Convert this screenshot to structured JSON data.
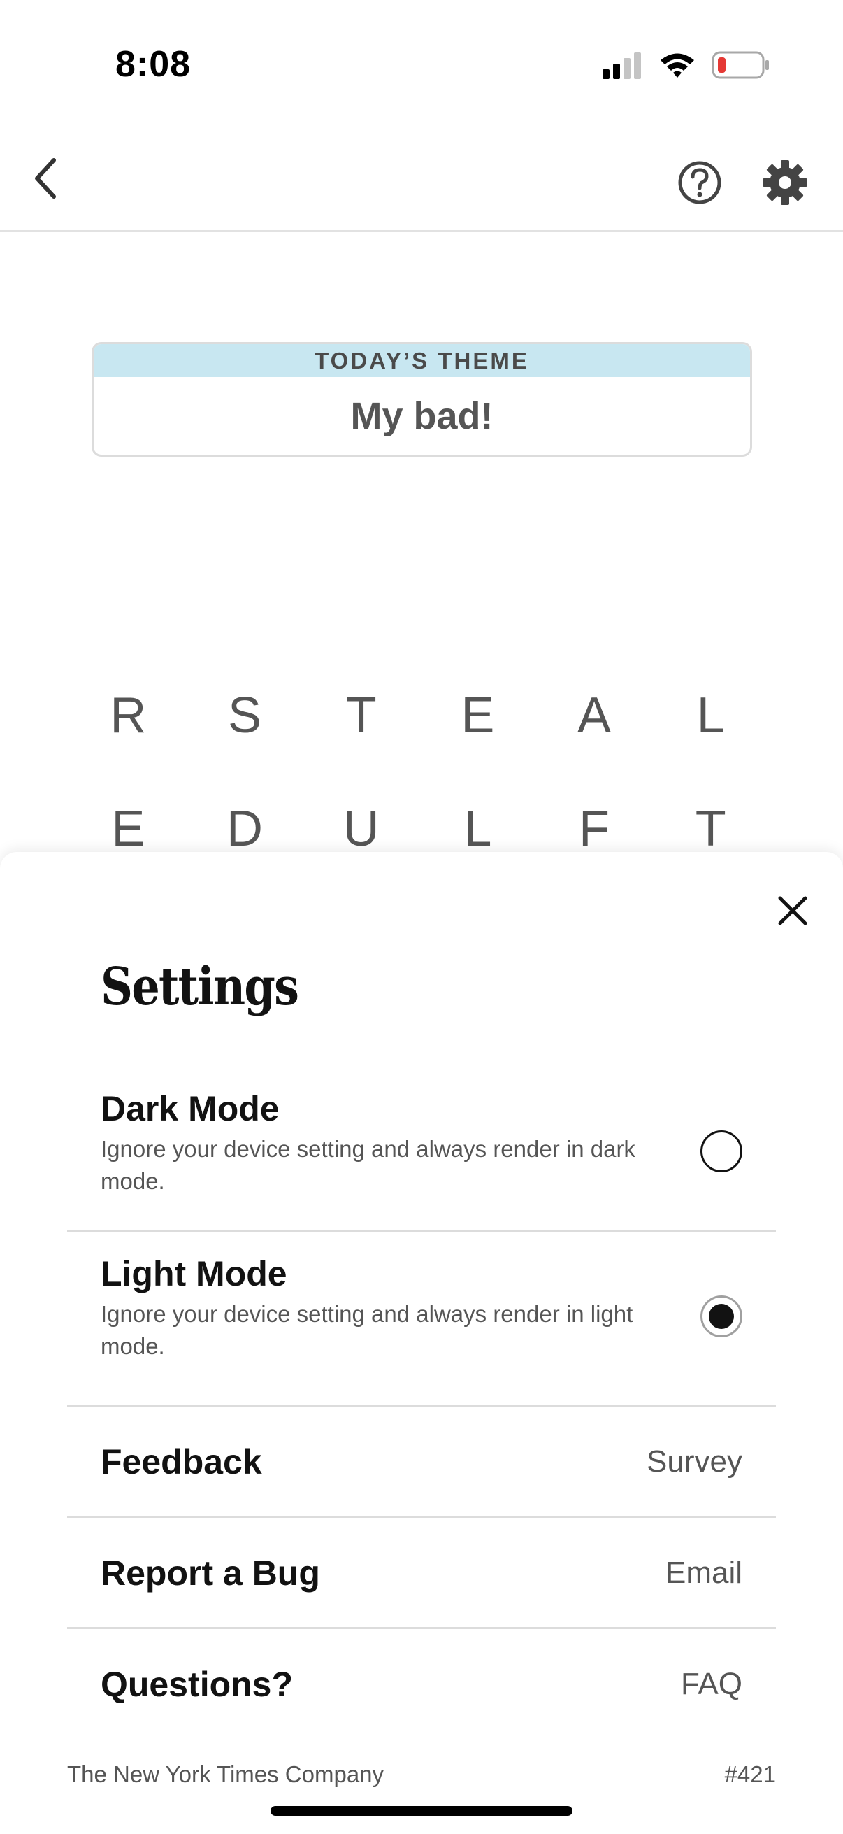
{
  "status_bar": {
    "time": "8:08",
    "icons": [
      "cellular-signal-icon",
      "wifi-icon",
      "battery-low-icon"
    ],
    "battery_color": "#e53935"
  },
  "nav": {
    "icons": [
      "chevron-left-icon",
      "help-circle-icon",
      "gear-icon"
    ]
  },
  "theme": {
    "header": "TODAY’S THEME",
    "value": "My bad!",
    "header_color": "#c8e7f1"
  },
  "grid": {
    "rows": [
      [
        "R",
        "S",
        "T",
        "E",
        "A",
        "L"
      ],
      [
        "E",
        "D",
        "U",
        "L",
        "F",
        "T"
      ]
    ]
  },
  "settings": {
    "title": "Settings",
    "close_icon": "close-icon",
    "options": [
      {
        "title": "Dark Mode",
        "description": "Ignore your device setting and always render in dark mode.",
        "selected": false
      },
      {
        "title": "Light Mode",
        "description": "Ignore your device setting and always render in light mode.",
        "selected": true
      }
    ],
    "links": [
      {
        "label": "Feedback",
        "value": "Survey"
      },
      {
        "label": "Report a Bug",
        "value": "Email"
      },
      {
        "label": "Questions?",
        "value": "FAQ"
      }
    ]
  },
  "footer": {
    "company": "The New York Times Company",
    "puzzle_number": "#421"
  }
}
